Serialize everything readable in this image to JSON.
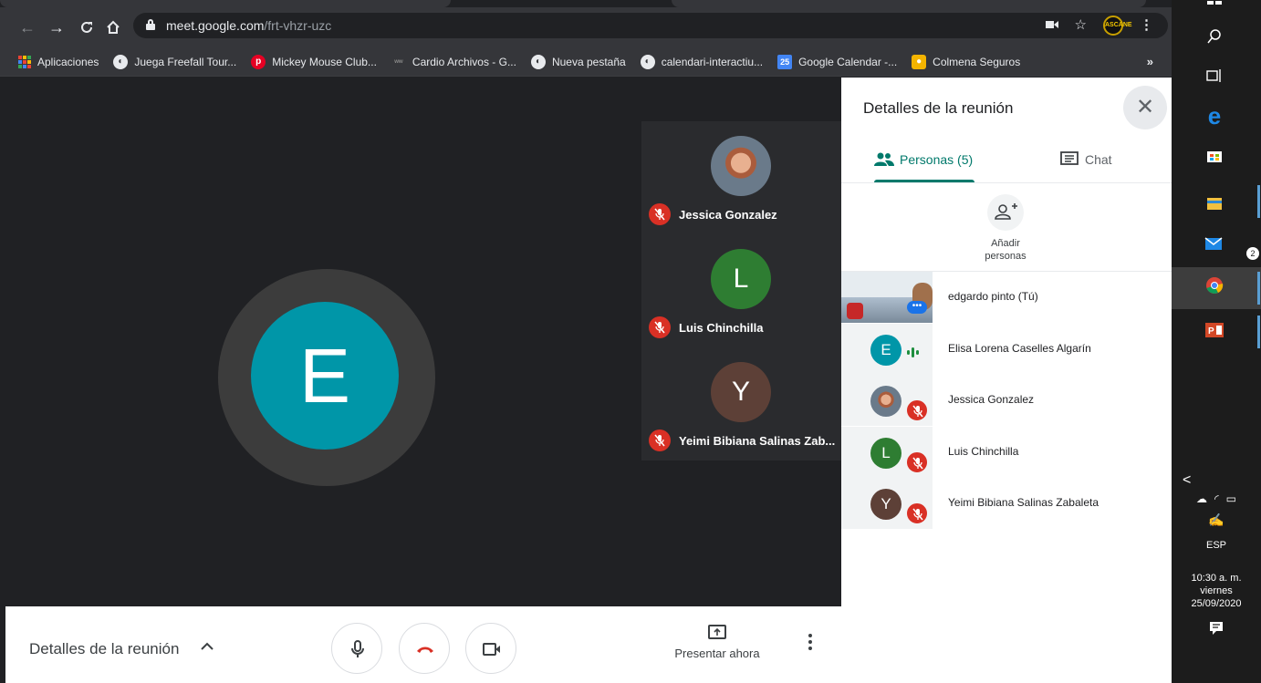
{
  "browser": {
    "url_host": "meet.google.com",
    "url_path": "/frt-vhzr-uzc",
    "bookmarks": [
      {
        "label": "Aplicaciones",
        "icon": "apps-grid-icon"
      },
      {
        "label": "Juega Freefall Tour...",
        "icon": "globe-icon"
      },
      {
        "label": "Mickey Mouse Club...",
        "icon": "pinterest-icon"
      },
      {
        "label": "Cardio Archivos - G...",
        "icon": "cardio-icon"
      },
      {
        "label": "Nueva pestaña",
        "icon": "globe-icon"
      },
      {
        "label": "calendari-interactiu...",
        "icon": "globe-icon"
      },
      {
        "label": "Google Calendar -...",
        "icon": "calendar-icon",
        "icon_text": "25"
      },
      {
        "label": "Colmena Seguros",
        "icon": "colmena-icon"
      }
    ],
    "bookmarks_more": "»",
    "extension_label": "ASCANE"
  },
  "stage": {
    "main_initial": "E",
    "main_color": "#0096a8",
    "tiles": [
      {
        "name": "Jessica Gonzalez",
        "avatar": "photo"
      },
      {
        "name": "Luis Chinchilla",
        "initial": "L",
        "color": "#2e7d32"
      },
      {
        "name": "Yeimi Bibiana Salinas Zab...",
        "initial": "Y",
        "color": "#5d4037"
      }
    ]
  },
  "controls": {
    "details_label": "Detalles de la reunión",
    "chevron": "^",
    "present_label": "Presentar ahora"
  },
  "panel": {
    "title": "Detalles de la reunión",
    "close": "✕",
    "tab_people": "Personas (5)",
    "tab_chat": "Chat",
    "add_people_line1": "Añadir",
    "add_people_line2": "personas",
    "people": [
      {
        "name": "edgardo pinto (Tú)",
        "avatar": "video",
        "muted": false
      },
      {
        "name": "Elisa Lorena Caselles Algarín",
        "initial": "E",
        "color": "#0096a8",
        "muted": false,
        "speaking": true
      },
      {
        "name": "Jessica Gonzalez",
        "avatar": "photo",
        "muted": true
      },
      {
        "name": "Luis Chinchilla",
        "initial": "L",
        "color": "#2e7d32",
        "muted": true
      },
      {
        "name": "Yeimi Bibiana Salinas Zabaleta",
        "initial": "Y",
        "color": "#5d4037",
        "muted": true
      }
    ]
  },
  "taskbar": {
    "mail_badge": "2",
    "language": "ESP",
    "time": "10:30 a. m.",
    "day": "viernes",
    "date": "25/09/2020",
    "collapse": "<"
  }
}
